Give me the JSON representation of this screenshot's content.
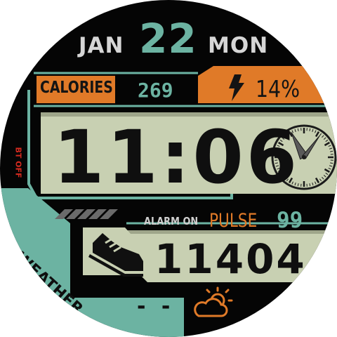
{
  "date": {
    "month": "JAN",
    "day": "22",
    "weekday": "MON"
  },
  "calories": {
    "label": "CALORIES",
    "value": "269"
  },
  "battery": {
    "value": "14%",
    "icon": "lightning-icon"
  },
  "time": {
    "value": "11:06"
  },
  "bluetooth": {
    "status": "BT OFF"
  },
  "alarm": {
    "status": "ALARM ON"
  },
  "pulse": {
    "label": "PULSE",
    "value": "99"
  },
  "steps": {
    "value": "11404",
    "icon": "sneaker-icon"
  },
  "weather": {
    "label": "WEATHER",
    "temperature": "- -",
    "icon": "partly-cloudy-icon"
  },
  "analog_clock": {
    "hour": 11,
    "minute": 6
  },
  "colors": {
    "background": "#050505",
    "teal": "#6cb3a2",
    "orange": "#e07a28",
    "lcd": "#c8d0b2",
    "alert_red": "#d22a1f"
  }
}
